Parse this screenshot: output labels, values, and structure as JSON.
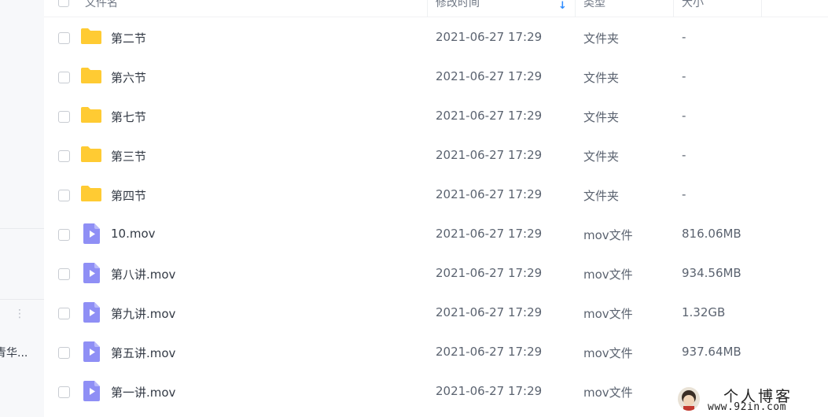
{
  "sidebar": {
    "more_glyph": "⋮",
    "item_text": "青华..."
  },
  "header": {
    "name_label": "文件名",
    "time_label": "修改时间",
    "type_label": "类型",
    "size_label": "大小",
    "sort_glyph": "↓"
  },
  "rows": [
    {
      "icon": "folder-icon",
      "name": "第二节",
      "time": "2021-06-27 17:29",
      "type": "文件夹",
      "size": "-"
    },
    {
      "icon": "folder-icon",
      "name": "第六节",
      "time": "2021-06-27 17:29",
      "type": "文件夹",
      "size": "-"
    },
    {
      "icon": "folder-icon",
      "name": "第七节",
      "time": "2021-06-27 17:29",
      "type": "文件夹",
      "size": "-"
    },
    {
      "icon": "folder-icon",
      "name": "第三节",
      "time": "2021-06-27 17:29",
      "type": "文件夹",
      "size": "-"
    },
    {
      "icon": "folder-icon",
      "name": "第四节",
      "time": "2021-06-27 17:29",
      "type": "文件夹",
      "size": "-"
    },
    {
      "icon": "video-file-icon",
      "name": "10.mov",
      "time": "2021-06-27 17:29",
      "type": "mov文件",
      "size": "816.06MB"
    },
    {
      "icon": "video-file-icon",
      "name": "第八讲.mov",
      "time": "2021-06-27 17:29",
      "type": "mov文件",
      "size": "934.56MB"
    },
    {
      "icon": "video-file-icon",
      "name": "第九讲.mov",
      "time": "2021-06-27 17:29",
      "type": "mov文件",
      "size": "1.32GB"
    },
    {
      "icon": "video-file-icon",
      "name": "第五讲.mov",
      "time": "2021-06-27 17:29",
      "type": "mov文件",
      "size": "937.64MB"
    },
    {
      "icon": "video-file-icon",
      "name": "第一讲.mov",
      "time": "2021-06-27 17:29",
      "type": "mov文件",
      "size": ""
    }
  ],
  "colors": {
    "folder": "#ffcb33",
    "video": "#8f8ff5",
    "sort_accent": "#2f8cff"
  },
  "watermark": {
    "title": "个人博客",
    "url": "www.92in.com"
  }
}
